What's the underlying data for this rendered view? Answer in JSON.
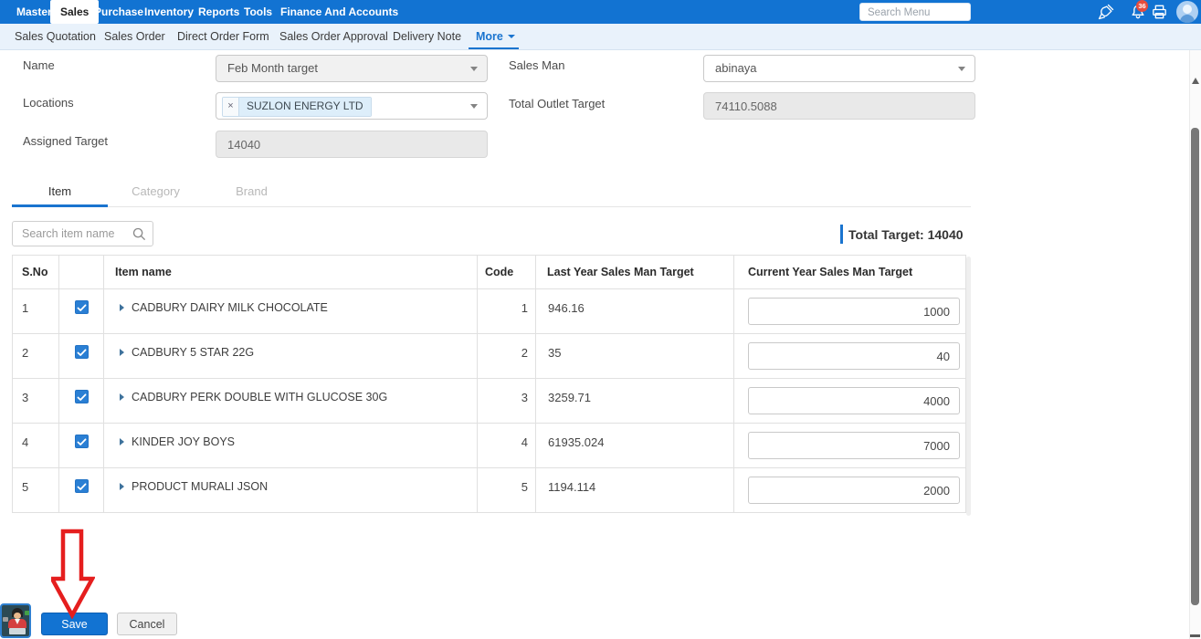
{
  "topnav": {
    "items": [
      "Master",
      "Sales",
      "Purchase",
      "Inventory",
      "Reports",
      "Tools",
      "Finance And Accounts"
    ],
    "active_item": "Sales",
    "search_placeholder": "Search Menu",
    "notification_count": "36"
  },
  "subnav": {
    "items": [
      "Sales Quotation",
      "Sales Order",
      "Direct Order Form",
      "Sales Order Approval",
      "Delivery Note"
    ],
    "more_label": "More"
  },
  "form": {
    "name": {
      "label": "Name",
      "value": "Feb Month target"
    },
    "sales_man": {
      "label": "Sales Man",
      "value": "abinaya"
    },
    "locations": {
      "label": "Locations",
      "tag": "SUZLON ENERGY LTD",
      "remove": "×"
    },
    "total_outlet_target": {
      "label": "Total Outlet Target",
      "value": "74110.5088"
    },
    "assigned_target": {
      "label": "Assigned Target",
      "value": "14040"
    }
  },
  "tabs": {
    "items": [
      "Item",
      "Category",
      "Brand"
    ],
    "active": "Item"
  },
  "item_search": {
    "placeholder": "Search item name"
  },
  "total_target": {
    "label": "Total Target:",
    "value": "14040"
  },
  "table": {
    "headers": {
      "sno": "S.No",
      "item": "Item name",
      "code": "Code",
      "last_year": "Last Year Sales Man Target",
      "current_year": "Current Year Sales Man Target"
    },
    "rows": [
      {
        "sno": "1",
        "checked": true,
        "item": "CADBURY DAIRY MILK CHOCOLATE",
        "code": "1",
        "last_year": "946.16",
        "current_year": "1000"
      },
      {
        "sno": "2",
        "checked": true,
        "item": "CADBURY 5 STAR 22G",
        "code": "2",
        "last_year": "35",
        "current_year": "40"
      },
      {
        "sno": "3",
        "checked": true,
        "item": "CADBURY PERK DOUBLE WITH GLUCOSE 30G",
        "code": "3",
        "last_year": "3259.71",
        "current_year": "4000"
      },
      {
        "sno": "4",
        "checked": true,
        "item": "KINDER JOY BOYS",
        "code": "4",
        "last_year": "61935.024",
        "current_year": "7000"
      },
      {
        "sno": "5",
        "checked": true,
        "item": "PRODUCT MURALI JSON",
        "code": "5",
        "last_year": "1194.114",
        "current_year": "2000"
      }
    ]
  },
  "footer": {
    "save_label": "Save",
    "cancel_label": "Cancel"
  },
  "colors": {
    "nav_blue": "#1273d2",
    "subnav_bg": "#e9f2fb",
    "accent_blue": "#1a74cf",
    "badge_red": "#e74c3c",
    "checkbox_blue": "#2a7fd4",
    "arrow_red": "#e51e1e"
  }
}
